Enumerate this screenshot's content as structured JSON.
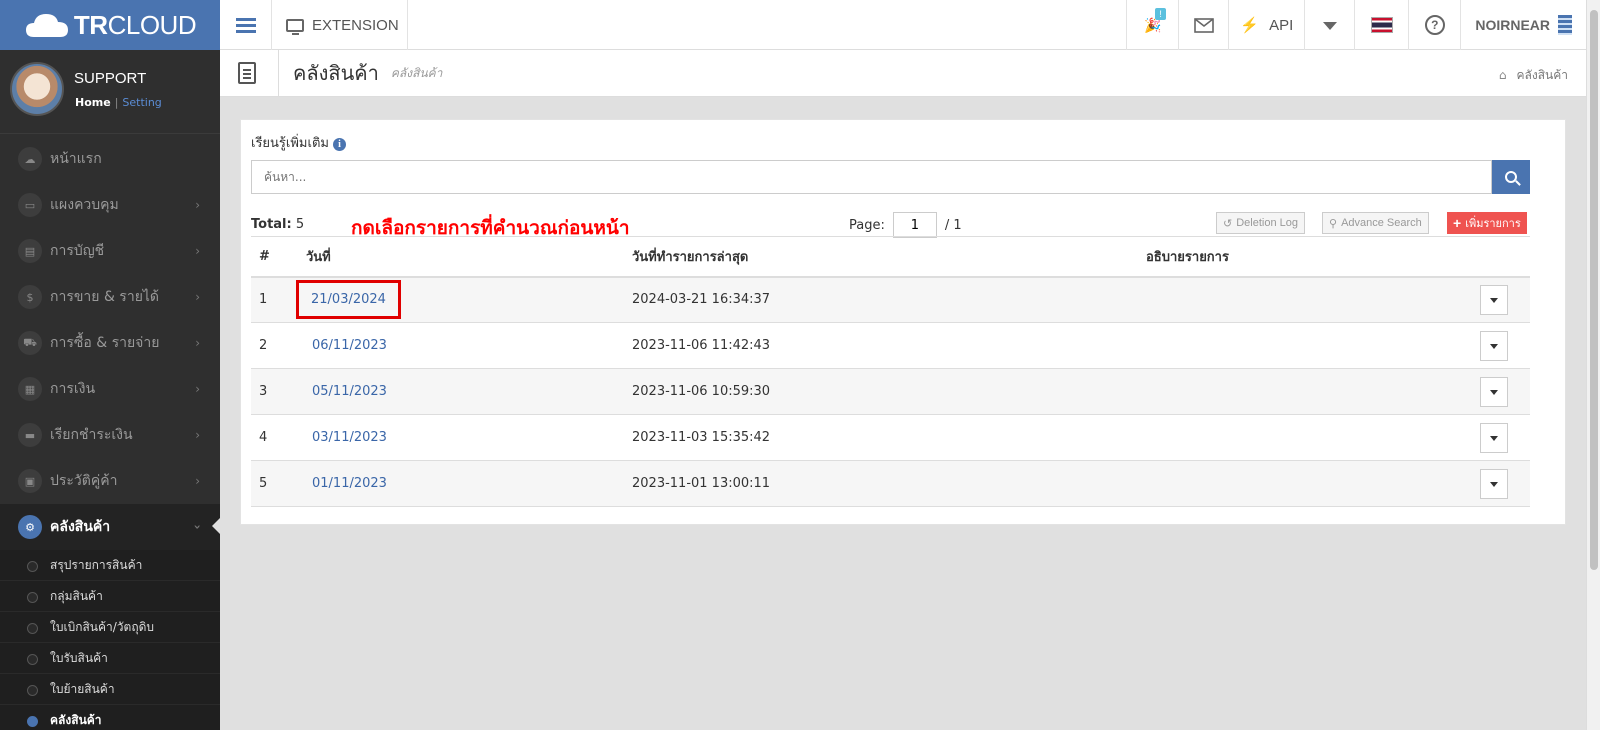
{
  "app": {
    "brand_bold": "TR",
    "brand_light": "CLOUD"
  },
  "topbar": {
    "extension_label": "EXTENSION",
    "notif_badge": "!",
    "api_label": "API",
    "user_label": "NOIRNEAR"
  },
  "sidebar": {
    "profile_name": "SUPPORT",
    "home_link": "Home",
    "setting_link": "Setting",
    "items": [
      {
        "label": "หน้าแรก",
        "icon": "☁"
      },
      {
        "label": "แผงควบคุม",
        "icon": "▭"
      },
      {
        "label": "การบัญชี",
        "icon": "▤"
      },
      {
        "label": "การขาย & รายได้",
        "icon": "$"
      },
      {
        "label": "การซื้อ & รายจ่าย",
        "icon": "⛟"
      },
      {
        "label": "การเงิน",
        "icon": "▦"
      },
      {
        "label": "เรียกชำระเงิน",
        "icon": "▬"
      },
      {
        "label": "ประวัติคู่ค้า",
        "icon": "▣"
      },
      {
        "label": "คลังสินค้า",
        "icon": "⚙"
      }
    ],
    "sub_items": [
      "สรุปรายการสินค้า",
      "กลุ่มสินค้า",
      "ใบเบิกสินค้า/วัตถุดิบ",
      "ใบรับสินค้า",
      "ใบย้ายสินค้า",
      "คลังสินค้า"
    ]
  },
  "page": {
    "title": "คลังสินค้า",
    "subtitle": "คลังสินค้า",
    "breadcrumb": "คลังสินค้า"
  },
  "panel": {
    "learn_more": "เรียนรู้เพิ่มเติม",
    "search_placeholder": "ค้นหา...",
    "total_label": "Total:",
    "total_value": "5",
    "annotation": "กดเลือกรายการที่คำนวณก่อนหน้า",
    "page_label": "Page:",
    "page_value": "1",
    "page_total": "/ 1",
    "deletion_log": "Deletion Log",
    "advance_search": "Advance Search",
    "add_button": "เพิ่มรายการ"
  },
  "table": {
    "headers": [
      "#",
      "วันที่",
      "วันที่ทำรายการล่าสุด",
      "อธิบายรายการ"
    ],
    "rows": [
      {
        "no": "1",
        "date": "21/03/2024",
        "last": "2024-03-21 16:34:37",
        "desc": ""
      },
      {
        "no": "2",
        "date": "06/11/2023",
        "last": "2023-11-06 11:42:43",
        "desc": ""
      },
      {
        "no": "3",
        "date": "05/11/2023",
        "last": "2023-11-06 10:59:30",
        "desc": ""
      },
      {
        "no": "4",
        "date": "03/11/2023",
        "last": "2023-11-03 15:35:42",
        "desc": ""
      },
      {
        "no": "5",
        "date": "01/11/2023",
        "last": "2023-11-01 13:00:11",
        "desc": ""
      }
    ]
  },
  "colors": {
    "brand": "#4a74b0",
    "annotation": "#ff0000",
    "add": "#ef5350"
  }
}
